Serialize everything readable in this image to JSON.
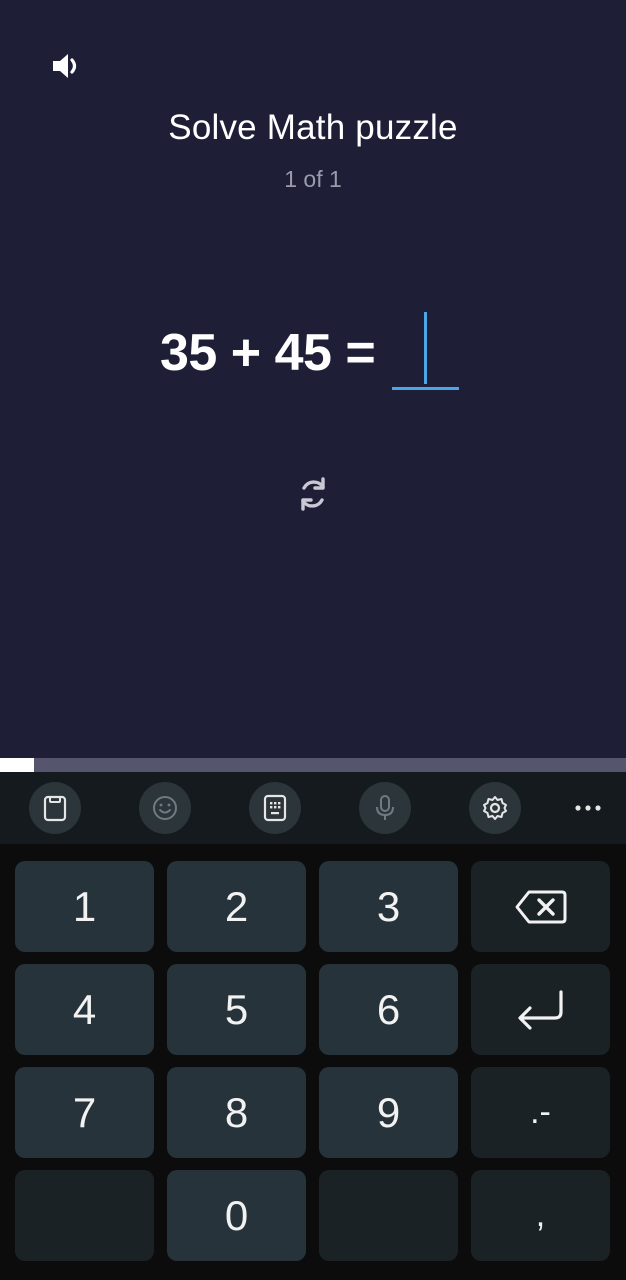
{
  "header": {
    "sound_icon": "speaker-icon",
    "title": "Solve Math puzzle",
    "counter": "1 of 1"
  },
  "puzzle": {
    "equation": "35 + 45 = ",
    "answer_value": "",
    "refresh_icon": "refresh-icon"
  },
  "progress": {
    "fraction": 0.055,
    "fill_color": "#ffffff",
    "track_color": "#55556e"
  },
  "keyboard_toolbar": {
    "items": [
      "clipboard-icon",
      "emoji-icon",
      "keypad-icon",
      "microphone-icon",
      "settings-icon",
      "more-icon"
    ]
  },
  "keyboard": {
    "keys": {
      "k1": "1",
      "k2": "2",
      "k3": "3",
      "k4": "4",
      "k5": "5",
      "k6": "6",
      "k7": "7",
      "k8": "8",
      "k9": "9",
      "k0": "0",
      "dot_dash": ".-",
      "comma": ","
    },
    "backspace_icon": "backspace-icon",
    "enter_icon": "enter-icon"
  },
  "colors": {
    "background": "#1e1e36",
    "accent": "#4aa6e6",
    "key": "#26333b",
    "key_dark": "#1a2226"
  }
}
